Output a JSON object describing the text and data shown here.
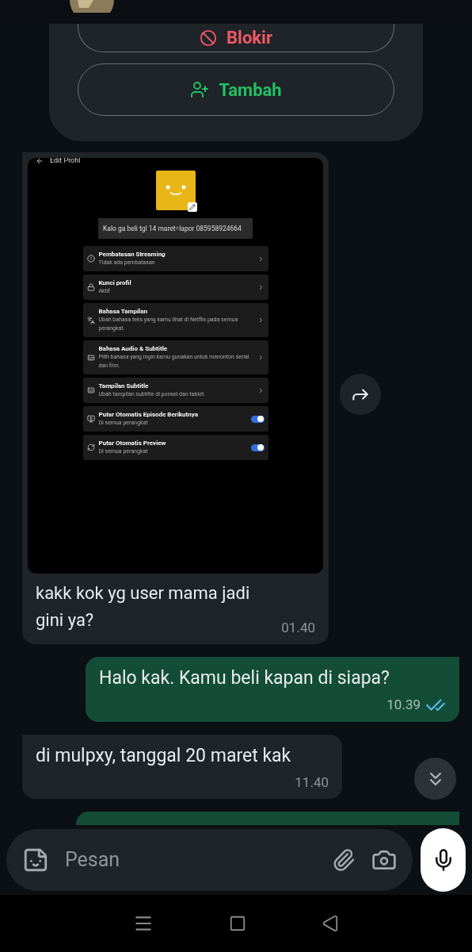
{
  "contact_card": {
    "buttons": [
      {
        "kind": "block",
        "label": "Blokir"
      },
      {
        "kind": "add",
        "label": "Tambah"
      }
    ]
  },
  "messages": [
    {
      "kind": "image",
      "incoming": true,
      "text": "kakk kok yg user mama jadi gini ya?",
      "time": "01.40",
      "screenshot": {
        "title": "Edit Profil",
        "profile_name": "Kalo ga beli tgl 14 maret=lapor 085958924664",
        "settings": [
          {
            "kind": "link",
            "title": "Pembatasan Streaming",
            "subtitle": "Tidak ada pembatasan"
          },
          {
            "kind": "link",
            "title": "Kunci profil",
            "subtitle": "Aktif"
          },
          {
            "kind": "link",
            "title": "Bahasa Tampilan",
            "subtitle": "Ubah bahasa teks yang kamu lihat di Netflix pada semua perangkat."
          },
          {
            "kind": "link",
            "title": "Bahasa Audio & Subtitle",
            "subtitle": "Pilih bahasa yang ingin kamu gunakan untuk menonton serial dan film."
          },
          {
            "kind": "link",
            "title": "Tampilan Subtitle",
            "subtitle": "Ubah tampilan subtitle di ponsel dan tablet."
          },
          {
            "kind": "toggle",
            "title": "Putar Otomatis Episode Berikutnya",
            "subtitle": "Di semua perangkat",
            "on": true
          },
          {
            "kind": "toggle",
            "title": "Putar Otomatis Preview",
            "subtitle": "Di semua perangkat",
            "on": true
          }
        ]
      }
    },
    {
      "kind": "text",
      "incoming": false,
      "text": "Halo kak. Kamu beli kapan di siapa?",
      "time": "10.39",
      "read": true
    },
    {
      "kind": "text",
      "incoming": true,
      "text": "di mulpxy, tanggal 20 maret kak",
      "time": "11.40"
    }
  ],
  "composer": {
    "placeholder": "Pesan"
  }
}
